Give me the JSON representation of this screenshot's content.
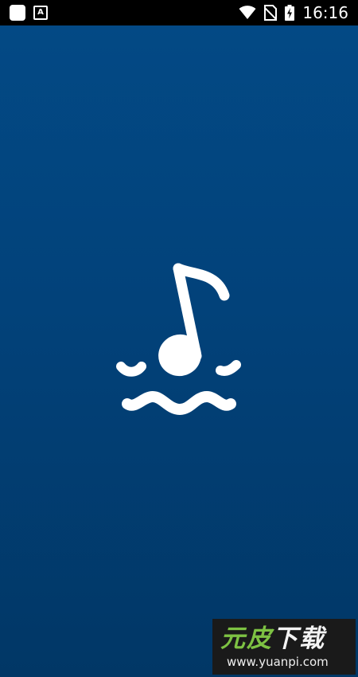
{
  "status_bar": {
    "time": "16:16",
    "notification_icons": [
      "app-square-icon",
      "a-icon"
    ],
    "system_icons": [
      "wifi-icon",
      "no-sim-icon",
      "battery-charging-icon"
    ]
  },
  "splash": {
    "logo_icon": "music-note-waves-icon",
    "background_color": "#03467f"
  },
  "watermark": {
    "title_part1": "元皮",
    "title_part2": "下载",
    "url": "www.yuanpi.com",
    "accent_color": "#7dc243"
  }
}
